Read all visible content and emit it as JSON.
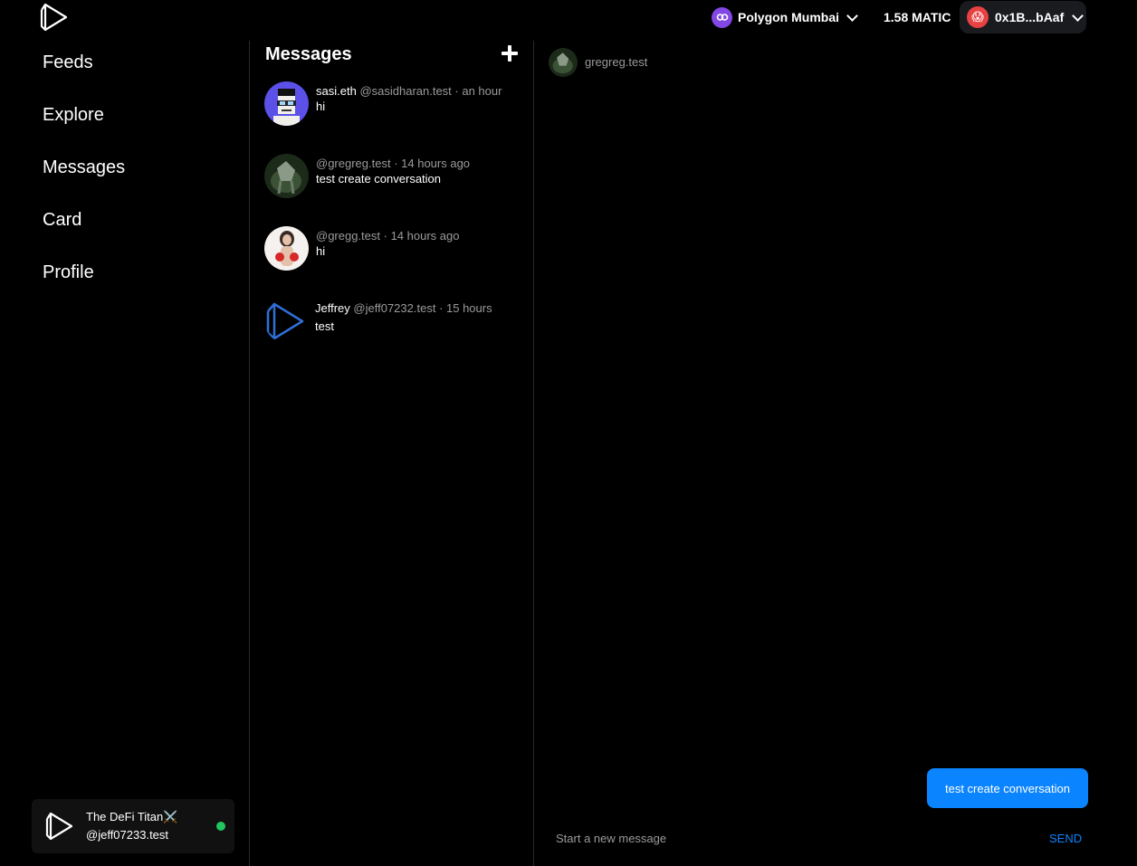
{
  "header": {
    "network": "Polygon Mumbai",
    "balance": "1.58 MATIC",
    "account": "0x1B...bAaf",
    "account_emoji": "😱"
  },
  "sidebar": {
    "items": [
      {
        "label": "Feeds"
      },
      {
        "label": "Explore"
      },
      {
        "label": "Messages"
      },
      {
        "label": "Card"
      },
      {
        "label": "Profile"
      }
    ],
    "profile": {
      "name": "The DeFi Titan⚔️",
      "handle": "@jeff07233.test"
    }
  },
  "messages": {
    "title": "Messages",
    "conversations": [
      {
        "name": "sasi.eth",
        "handle": "@sasidharan.test",
        "time": "· an hour",
        "preview": "hi"
      },
      {
        "name": "",
        "handle": "@gregreg.test",
        "time": "· 14 hours ago",
        "preview": "test create conversation"
      },
      {
        "name": "",
        "handle": "@gregg.test",
        "time": "· 14 hours ago",
        "preview": "hi"
      },
      {
        "name": "Jeffrey",
        "handle": "@jeff07232.test",
        "time": "· 15 hours",
        "preview": "test"
      }
    ]
  },
  "chat": {
    "recipient": "gregreg.test",
    "messages": [
      {
        "text": "test create conversation"
      }
    ],
    "input_placeholder": "Start a new message",
    "send_label": "SEND"
  },
  "colors": {
    "accent": "#0a84ff",
    "online": "#22c55e",
    "network": "#8247e5"
  }
}
